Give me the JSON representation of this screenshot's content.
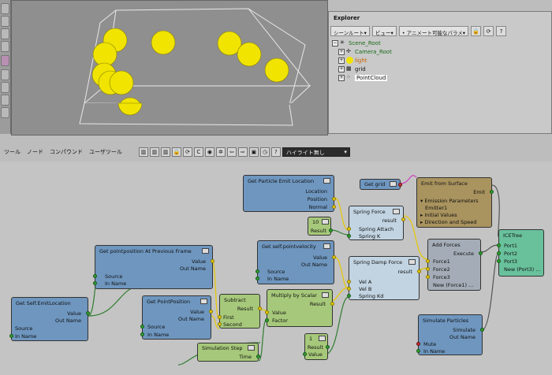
{
  "explorer": {
    "title": "Explorer",
    "toolbar": {
      "scene_root_dropdown": "シーンルート▾",
      "view_dropdown": "ビュー▾",
      "filter_dropdown": "• アニメート可能なパラメ▾"
    },
    "tree": [
      {
        "label": "Scene_Root",
        "color": "#1a6a1a"
      },
      {
        "label": "Camera_Root",
        "color": "#1a6a1a"
      },
      {
        "label": "light",
        "color": "#c86400"
      },
      {
        "label": "grid",
        "color": "#111111"
      },
      {
        "label": "PointCloud",
        "color": "#111111",
        "selected": true
      }
    ]
  },
  "ice_menu": {
    "items": [
      "ツール",
      "ノード",
      "コンパウンド",
      "ユーザツール"
    ],
    "highlight_dropdown": "ハイライト無し"
  },
  "nodes": {
    "get_particle_emit_location": {
      "title": "Get Particle Emit Location",
      "outputs": [
        "Location",
        "Position",
        "Normal"
      ]
    },
    "get_grid": {
      "title": "Get grid"
    },
    "emit_from_surface": {
      "title": "Emit from Surface",
      "output": "Emit",
      "rows": [
        "▾ Emission Parameters",
        "Emitter1",
        "▸ Initial Values",
        "▸ Direction and Speed"
      ]
    },
    "spring_force": {
      "title": "Spring Force",
      "output": "result",
      "inputs": [
        "Spring Attach",
        "Spring K"
      ]
    },
    "scalar_10": {
      "value": "10",
      "output": "Result"
    },
    "get_self_pointvelocity": {
      "title": "Get self.pointvelocity",
      "outputs": [
        "Value",
        "Out Name"
      ],
      "inputs": [
        "Source",
        "In Name"
      ]
    },
    "get_pointposition_prev": {
      "title": "Get pointposition At Previous Frame",
      "outputs": [
        "Value",
        "Out Name"
      ],
      "inputs": [
        "Source",
        "In Name"
      ]
    },
    "spring_damp_force": {
      "title": "Spring Damp Force",
      "output": "result",
      "inputs": [
        "Vel A",
        "Vel B",
        "Spring Kd"
      ]
    },
    "add_forces": {
      "title": "Add Forces",
      "output": "Execute",
      "inputs": [
        "Force1",
        "Force2",
        "Force3",
        "New (Force1) ..."
      ]
    },
    "ice_tree": {
      "title": "ICETree",
      "inputs": [
        "Port1",
        "Port2",
        "Port3",
        "New (Port3) ..."
      ]
    },
    "get_self_emitlocation": {
      "title": "Get Self.EmitLocation",
      "outputs": [
        "Value",
        "Out Name"
      ],
      "inputs": [
        "Source",
        "In Name"
      ]
    },
    "get_pointposition": {
      "title": "Get PointPosition",
      "outputs": [
        "Value",
        "Out Name"
      ],
      "inputs": [
        "Source",
        "In Name"
      ]
    },
    "subtract": {
      "title": "Subtract",
      "output": "Result",
      "inputs": [
        "First",
        "Second"
      ]
    },
    "multiply_by_scalar": {
      "title": "Multiply by Scalar",
      "output": "Result",
      "inputs": [
        "Value",
        "Factor"
      ]
    },
    "simulation_step": {
      "title": "Simulation Step",
      "output": "Time"
    },
    "scalar_1": {
      "value": "1",
      "output": "Result",
      "input": "Value"
    },
    "simulate_particles": {
      "title": "Simulate Particles",
      "outputs": [
        "Simulate",
        "Out Name"
      ],
      "inputs": [
        "Mute",
        "In Name"
      ]
    }
  },
  "colors": {
    "get_node": "#6e96bf",
    "math_node": "#a6c87a",
    "compound_node": "#c2d4e2",
    "emit_node": "#a9935e",
    "execute_node": "#a4adb7",
    "tree_node": "#69c19c",
    "particle": "#f0e400"
  }
}
